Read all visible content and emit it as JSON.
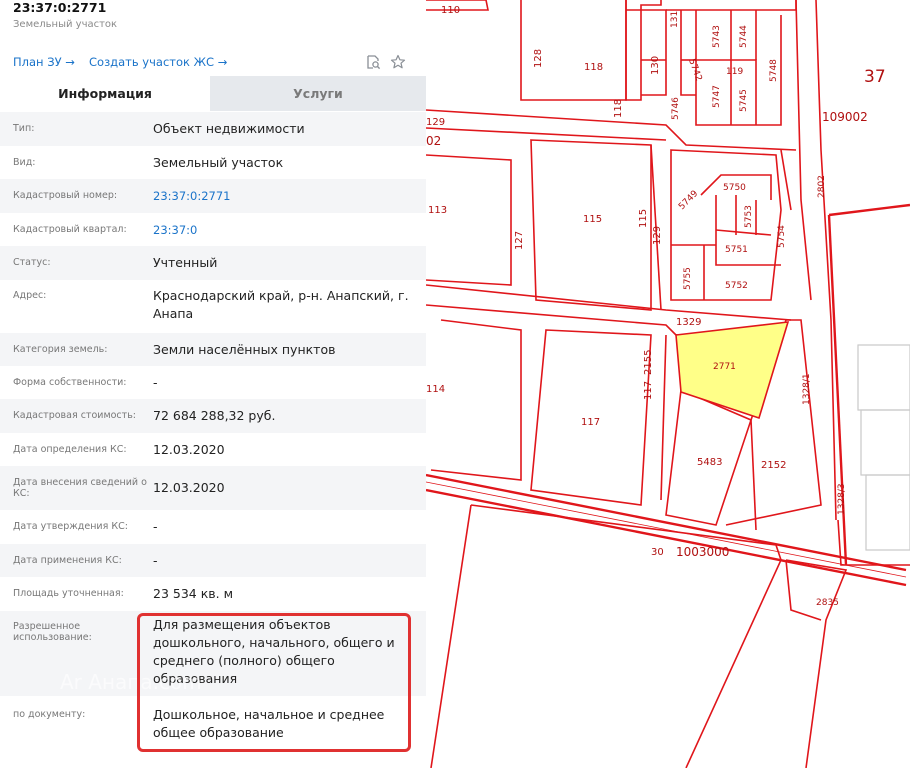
{
  "header": {
    "title": "23:37:0:2771",
    "subtitle": "Земельный участок"
  },
  "links": {
    "plan": "План ЗУ →",
    "create": "Создать участок ЖС →"
  },
  "tabs": {
    "info": "Информация",
    "services": "Услуги"
  },
  "rows": [
    {
      "label": "Тип:",
      "value": "Объект недвижимости"
    },
    {
      "label": "Вид:",
      "value": "Земельный участок"
    },
    {
      "label": "Кадастровый номер:",
      "value": "23:37:0:2771"
    },
    {
      "label": "Кадастровый квартал:",
      "value": "23:37:0"
    },
    {
      "label": "Статус:",
      "value": "Учтенный"
    },
    {
      "label": "Адрес:",
      "value": "Краснодарский край, р-н. Анапский, г. Анапа"
    },
    {
      "label": "Категория земель:",
      "value": "Земли населённых пунктов"
    },
    {
      "label": "Форма собственности:",
      "value": "-"
    },
    {
      "label": "Кадастровая стоимость:",
      "value": "72 684 288,32 руб."
    },
    {
      "label": "Дата определения КС:",
      "value": "12.03.2020"
    },
    {
      "label": "Дата внесения сведений о КС:",
      "value": "12.03.2020"
    },
    {
      "label": "Дата утверждения КС:",
      "value": "-"
    },
    {
      "label": "Дата применения КС:",
      "value": "-"
    },
    {
      "label": "Площадь уточненная:",
      "value": "23 534 кв. м"
    },
    {
      "label": "Разрешенное использование:",
      "value": "Для размещения объектов дошкольного, начального, общего и среднего (полного) общего образования"
    },
    {
      "label": "по документу:",
      "value": "Дошкольное, начальное и среднее общее образование"
    }
  ],
  "watermark": "Ar Анапа.com",
  "map": {
    "labels": [
      "110",
      "37",
      "128",
      "118",
      "130",
      "131",
      "5742",
      "5743",
      "5744",
      "119",
      "5748",
      "5746",
      "5747",
      "5745",
      "109002",
      "129",
      "02",
      "118",
      "113",
      "115",
      "115",
      "127",
      "129",
      "5749",
      "5750",
      "5753",
      "5751",
      "5754",
      "5755",
      "5752",
      "2802",
      "1329",
      "2771",
      "2155",
      "117",
      "117",
      "1328/1",
      "114",
      "5483",
      "2152",
      "1328/3",
      "30",
      "1003000",
      "2835"
    ],
    "colors": {
      "line": "#e0161b",
      "highlight": "#ffff88"
    }
  }
}
